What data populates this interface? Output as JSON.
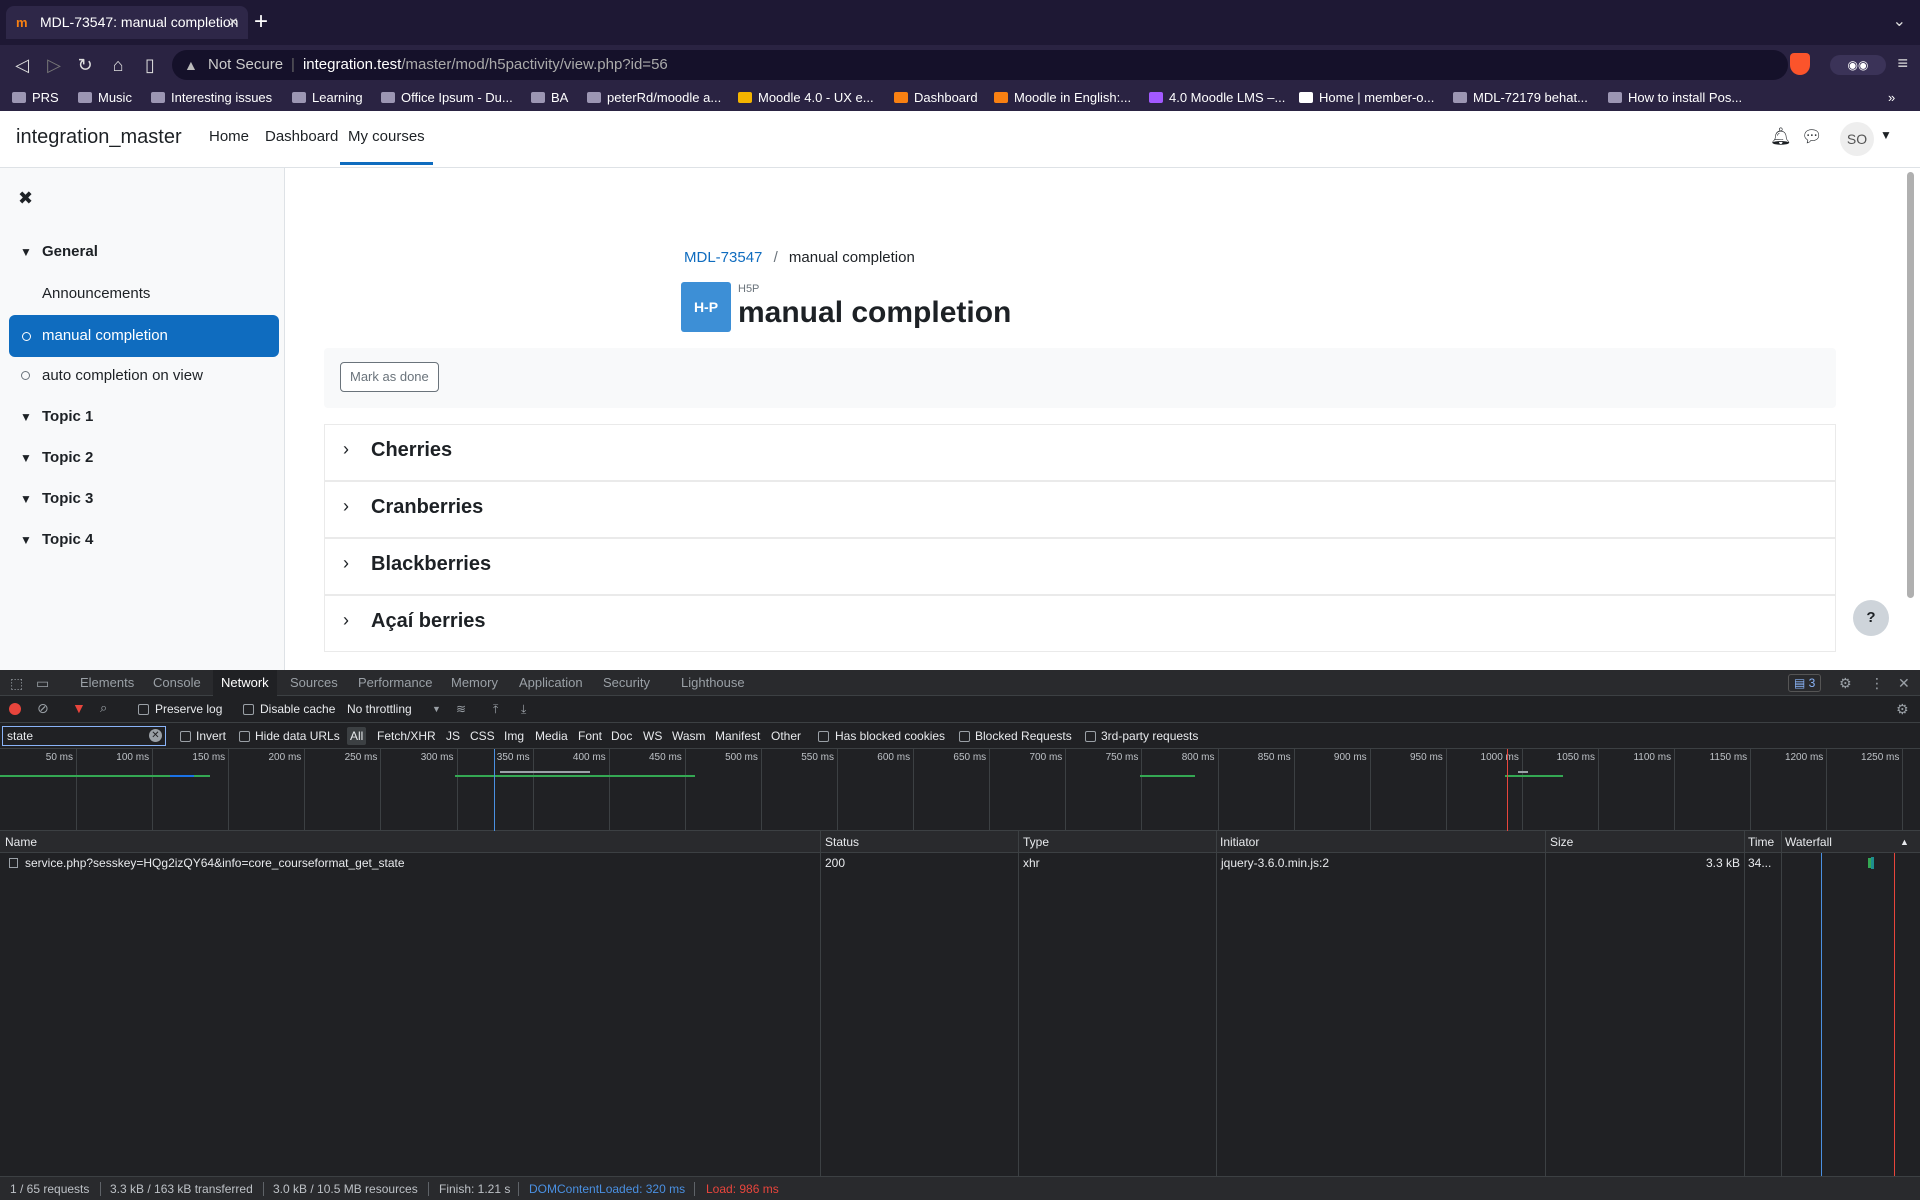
{
  "browser": {
    "tab_title": "MDL-73547: manual completion",
    "url_warning": "Not Secure",
    "url_domain": "integration.test",
    "url_path": "/master/mod/h5pactivity/view.php?id=56",
    "bookmarks": [
      "PRS",
      "Music",
      "Interesting issues",
      "Learning",
      "Office Ipsum - Du...",
      "BA",
      "peterRd/moodle a...",
      "Moodle 4.0 - UX e...",
      "Dashboard",
      "Moodle in English:...",
      "4.0 Moodle LMS –...",
      "Home | member-o...",
      "MDL-72179 behat...",
      "How to install Pos..."
    ]
  },
  "header": {
    "site_name": "integration_master",
    "nav": [
      "Home",
      "Dashboard",
      "My courses"
    ],
    "avatar_initials": "SO"
  },
  "sidebar": {
    "sections": [
      {
        "label": "General"
      },
      {
        "label": "Topic 1"
      },
      {
        "label": "Topic 2"
      },
      {
        "label": "Topic 3"
      },
      {
        "label": "Topic 4"
      }
    ],
    "activities": [
      "Announcements",
      "manual completion",
      "auto completion on view"
    ]
  },
  "main": {
    "breadcrumb_course": "MDL-73547",
    "breadcrumb_sep": "/",
    "breadcrumb_current": "manual completion",
    "module_icon_text": "H-P",
    "module_type": "H5P",
    "title": "manual completion",
    "mark_done_label": "Mark as done",
    "accordion": [
      "Cherries",
      "Cranberries",
      "Blackberries",
      "Açaí berries"
    ],
    "help_label": "?"
  },
  "devtools": {
    "tabs": [
      "Elements",
      "Console",
      "Network",
      "Sources",
      "Performance",
      "Memory",
      "Application",
      "Security",
      "Lighthouse"
    ],
    "issues_count": "3",
    "toolbar": {
      "preserve_log": "Preserve log",
      "disable_cache": "Disable cache",
      "throttling": "No throttling"
    },
    "filter": {
      "value": "state",
      "invert": "Invert",
      "hide_data_urls": "Hide data URLs",
      "types": [
        "All",
        "Fetch/XHR",
        "JS",
        "CSS",
        "Img",
        "Media",
        "Font",
        "Doc",
        "WS",
        "Wasm",
        "Manifest",
        "Other"
      ],
      "has_blocked_cookies": "Has blocked cookies",
      "blocked_requests": "Blocked Requests",
      "third_party": "3rd-party requests"
    },
    "timeline_ticks": [
      "50 ms",
      "100 ms",
      "150 ms",
      "200 ms",
      "250 ms",
      "300 ms",
      "350 ms",
      "400 ms",
      "450 ms",
      "500 ms",
      "550 ms",
      "600 ms",
      "650 ms",
      "700 ms",
      "750 ms",
      "800 ms",
      "850 ms",
      "900 ms",
      "950 ms",
      "1000 ms",
      "1050 ms",
      "1100 ms",
      "1150 ms",
      "1200 ms",
      "1250 ms"
    ],
    "columns": [
      "Name",
      "Status",
      "Type",
      "Initiator",
      "Size",
      "Time",
      "Waterfall"
    ],
    "rows": [
      {
        "name": "service.php?sesskey=HQg2izQY64&info=core_courseformat_get_state",
        "status": "200",
        "type": "xhr",
        "initiator": "jquery-3.6.0.min.js:2",
        "size": "3.3 kB",
        "time": "34..."
      }
    ],
    "status_bar": {
      "requests": "1 / 65 requests",
      "transferred": "3.3 kB / 163 kB transferred",
      "resources": "3.0 kB / 10.5 MB resources",
      "finish": "Finish: 1.21 s",
      "dcl": "DOMContentLoaded: 320 ms",
      "load": "Load: 986 ms"
    },
    "colors": {
      "dcl": "#4a90e2",
      "load": "#e8453c",
      "bar_green": "#34a853",
      "bar_blue": "#1a73e8"
    }
  }
}
